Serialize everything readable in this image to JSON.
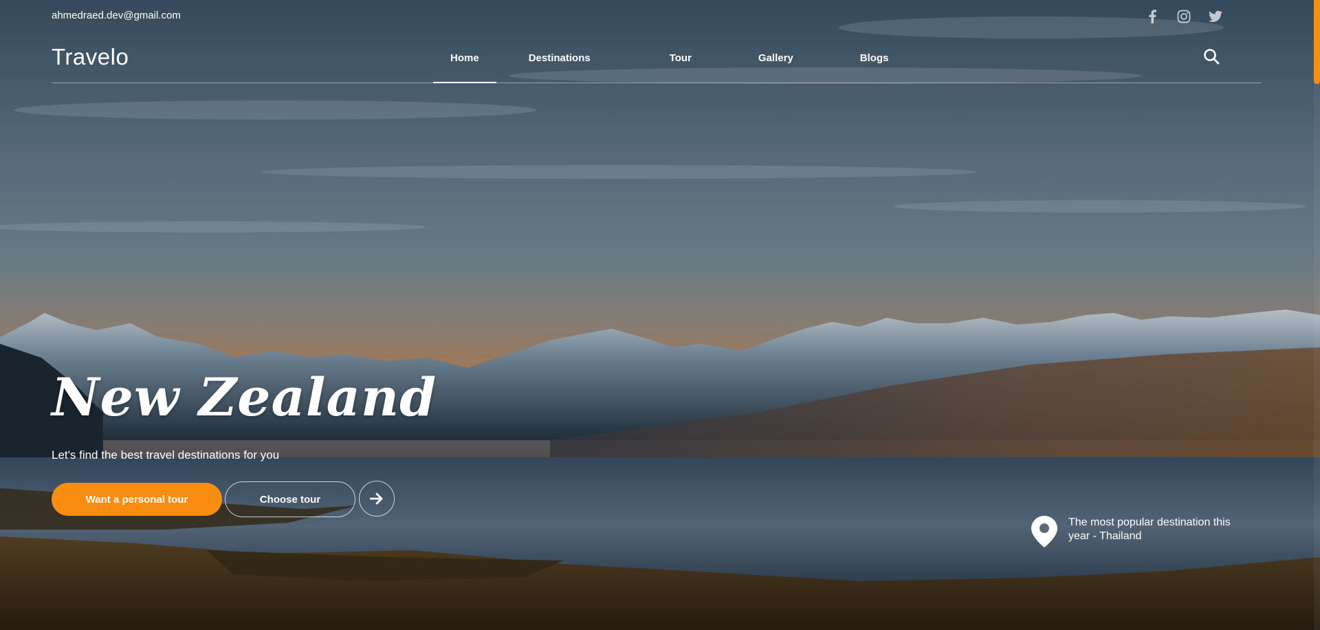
{
  "topbar": {
    "email": "ahmedraed.dev@gmail.com"
  },
  "socials": [
    {
      "icon": "facebook-icon"
    },
    {
      "icon": "instagram-icon"
    },
    {
      "icon": "twitter-icon"
    }
  ],
  "header": {
    "logo": "Travelo",
    "nav": [
      {
        "label": "Home",
        "active": true
      },
      {
        "label": "Destinations"
      },
      {
        "label": "Tour"
      },
      {
        "label": "Gallery"
      },
      {
        "label": "Blogs"
      }
    ],
    "search_icon": "search-icon"
  },
  "hero": {
    "title": "New Zealand",
    "subtitle": "Let's find the best travel destinations for you",
    "primary_button": "Want a personal tour",
    "secondary_button": "Choose tour",
    "arrow_icon": "arrow-right-icon",
    "popular": "The most popular destination this year - Thailand",
    "popular_icon": "location-pin-icon"
  },
  "colors": {
    "accent": "#f98d12",
    "text": "#ffffff"
  }
}
